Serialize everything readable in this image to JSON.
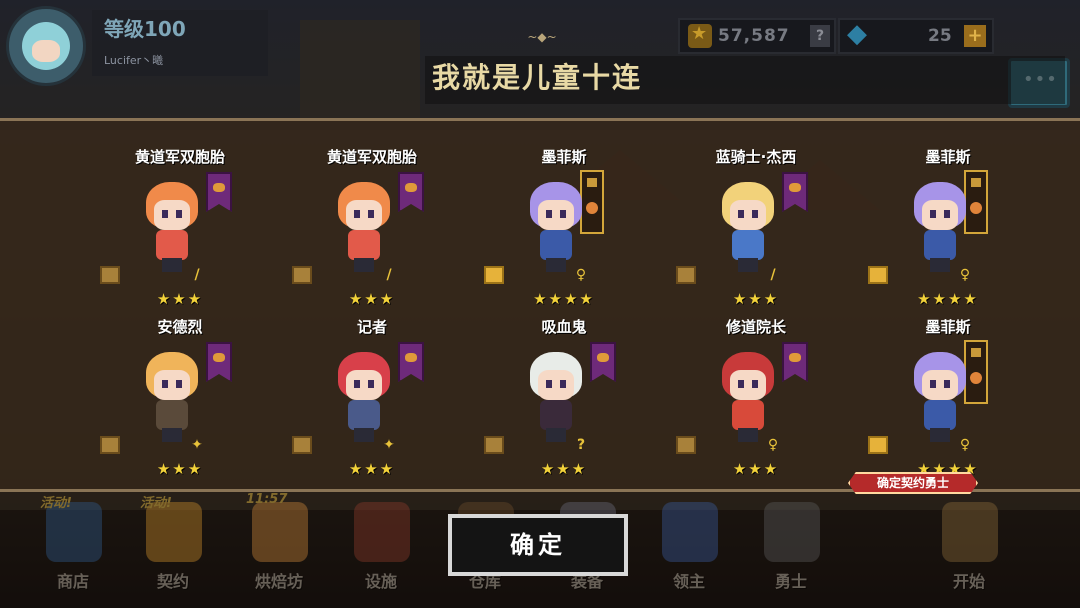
{
  "player": {
    "level": "等级100",
    "name": "Lucifer丶曦"
  },
  "currency": {
    "gold": "57,587",
    "gems": "25",
    "help": "?",
    "plus": "+"
  },
  "title": "我就是儿童十连",
  "results": [
    {
      "name": "黄道军双胞胎",
      "stars": "★★★",
      "hair": "#f08a4a",
      "outfit": "#e25a4a",
      "banner": "purple",
      "scroll": "normal",
      "weapon": "/"
    },
    {
      "name": "黄道军双胞胎",
      "stars": "★★★",
      "hair": "#f08a4a",
      "outfit": "#e25a4a",
      "banner": "purple",
      "scroll": "normal",
      "weapon": "/"
    },
    {
      "name": "墨菲斯",
      "stars": "★★★★",
      "hair": "#a794e8",
      "outfit": "#3b5aa8",
      "banner": "gold",
      "scroll": "gold",
      "weapon": "♀"
    },
    {
      "name": "蓝骑士·杰西",
      "stars": "★★★",
      "hair": "#f2d27a",
      "outfit": "#4a78c8",
      "banner": "purple",
      "scroll": "normal",
      "weapon": "/"
    },
    {
      "name": "墨菲斯",
      "stars": "★★★★",
      "hair": "#a794e8",
      "outfit": "#3b5aa8",
      "banner": "gold",
      "scroll": "gold",
      "weapon": "♀"
    },
    {
      "name": "安德烈",
      "stars": "★★★",
      "hair": "#f0b45a",
      "outfit": "#5a4a3a",
      "banner": "purple",
      "scroll": "normal",
      "weapon": "✦"
    },
    {
      "name": "记者",
      "stars": "★★★",
      "hair": "#d8404a",
      "outfit": "#4a5a8a",
      "banner": "purple",
      "scroll": "normal",
      "weapon": "✦"
    },
    {
      "name": "吸血鬼",
      "stars": "★★★",
      "hair": "#e8ece8",
      "outfit": "#3a2a3a",
      "banner": "purple",
      "scroll": "normal",
      "weapon": "?"
    },
    {
      "name": "修道院长",
      "stars": "★★★",
      "hair": "#c83a3a",
      "outfit": "#d84a3a",
      "banner": "purple",
      "scroll": "normal",
      "weapon": "♀"
    },
    {
      "name": "墨菲斯",
      "stars": "★★★★",
      "hair": "#a794e8",
      "outfit": "#3b5aa8",
      "banner": "gold",
      "scroll": "gold",
      "weapon": "♀"
    }
  ],
  "confirm_tag": "确定契约勇士",
  "ok_button": "确定",
  "nav": [
    {
      "label": "商店",
      "badge": "活动!",
      "color": "#2f5a8a"
    },
    {
      "label": "契约",
      "badge": "活动!",
      "color": "#c88a2a"
    },
    {
      "label": "烘焙坊",
      "badge": "11:57",
      "color": "#c8843a"
    },
    {
      "label": "设施",
      "badge": "",
      "color": "#8a3a2a"
    },
    {
      "label": "仓库",
      "badge": "",
      "color": "#6a4a2a"
    },
    {
      "label": "装备",
      "badge": "",
      "color": "#6a6a7a"
    },
    {
      "label": "领主",
      "badge": "",
      "color": "#3a5a9a"
    },
    {
      "label": "勇士",
      "badge": "",
      "color": "#5a5a5a"
    },
    {
      "label": "开始",
      "badge": "",
      "color": "#8a6a3a"
    }
  ]
}
